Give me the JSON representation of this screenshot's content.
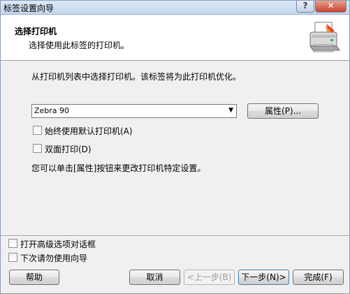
{
  "window": {
    "title": "标签设置向导",
    "help_glyph": "?",
    "close_glyph": "✕"
  },
  "header": {
    "title": "选择打印机",
    "subtitle": "选择使用此标签的打印机。",
    "icon": "printer-icon"
  },
  "main": {
    "instruction": "从打印机列表中选择打印机。该标签将为此打印机优化。",
    "printer_select": {
      "value": "Zebra 90"
    },
    "properties_button": "属性(P)...",
    "options": [
      {
        "label": "始终使用默认打印机(A)",
        "checked": false
      },
      {
        "label": "双面打印(D)",
        "checked": false
      }
    ],
    "hint": "您可以单击[属性]按钮来更改打印机特定设置。"
  },
  "footer": {
    "options": [
      {
        "label": "打开高级选项对话框",
        "checked": false
      },
      {
        "label": "下次请勿使用向导",
        "checked": false
      }
    ],
    "buttons": {
      "help": "帮助",
      "cancel": "取消",
      "back": "<上一步(B)",
      "next": "下一步(N)>",
      "finish": "完成(F)"
    }
  }
}
